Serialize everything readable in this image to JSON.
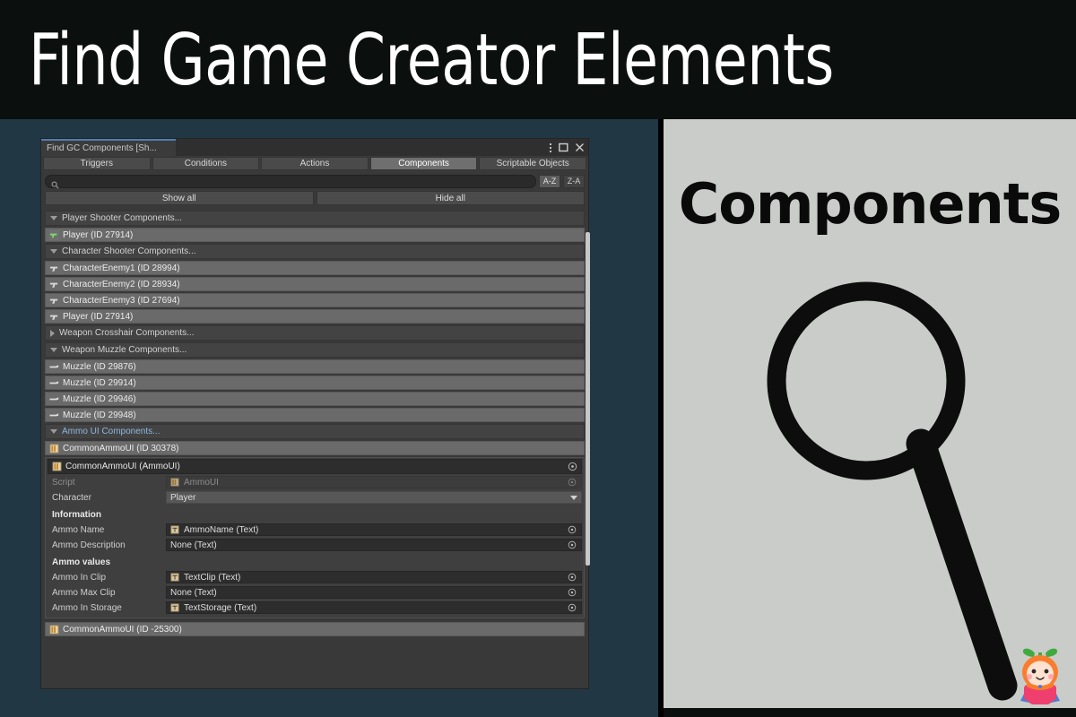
{
  "banner": {
    "title": "Find Game Creator Elements"
  },
  "right_panel": {
    "heading": "Components",
    "magnifier_icon": "search-icon",
    "mascot_icon": "mascot-character-icon",
    "bg_color": "#c9ccc9"
  },
  "window": {
    "tab_title": "Find GC Components [Sh...",
    "controls": {
      "menu": "kebab-menu-icon",
      "maximize": "maximize-icon",
      "close": "close-icon"
    },
    "accent_color": "#4b7fb5"
  },
  "tabs": [
    {
      "label": "Triggers",
      "active": false
    },
    {
      "label": "Conditions",
      "active": false
    },
    {
      "label": "Actions",
      "active": false
    },
    {
      "label": "Components",
      "active": true
    },
    {
      "label": "Scriptable Objects",
      "active": false
    }
  ],
  "search": {
    "value": "",
    "placeholder": "",
    "icon": "search-icon"
  },
  "sort": {
    "asc_label": "A-Z",
    "desc_label": "Z-A",
    "selected": "A-Z"
  },
  "actions": {
    "show_all": "Show all",
    "hide_all": "Hide all"
  },
  "groups": [
    {
      "label": "Player Shooter Components...",
      "expanded": true,
      "accent": false,
      "icon": "player-shooter-icon",
      "items": [
        {
          "label": "Player (ID 27914)",
          "icon": "gun-green-icon"
        }
      ]
    },
    {
      "label": "Character Shooter Components...",
      "expanded": true,
      "accent": false,
      "icon": "character-shooter-icon",
      "items": [
        {
          "label": "CharacterEnemy1 (ID 28994)",
          "icon": "gun-icon"
        },
        {
          "label": "CharacterEnemy2 (ID 28934)",
          "icon": "gun-icon"
        },
        {
          "label": "CharacterEnemy3 (ID 27694)",
          "icon": "gun-icon"
        },
        {
          "label": "Player (ID 27914)",
          "icon": "gun-icon"
        }
      ]
    },
    {
      "label": "Weapon Crosshair Components...",
      "expanded": false,
      "accent": false,
      "items": []
    },
    {
      "label": "Weapon Muzzle Components...",
      "expanded": true,
      "accent": false,
      "items": [
        {
          "label": "Muzzle (ID 29876)",
          "icon": "muzzle-icon"
        },
        {
          "label": "Muzzle (ID 29914)",
          "icon": "muzzle-icon"
        },
        {
          "label": "Muzzle (ID 29946)",
          "icon": "muzzle-icon"
        },
        {
          "label": "Muzzle (ID 29948)",
          "icon": "muzzle-icon"
        }
      ]
    },
    {
      "label": "Ammo UI Components...",
      "expanded": true,
      "accent": true,
      "items": [
        {
          "label": "CommonAmmoUI (ID 30378)",
          "icon": "ui-script-icon"
        }
      ]
    }
  ],
  "inspector": {
    "header": {
      "label": "CommonAmmoUI (AmmoUI)",
      "icon": "ui-script-icon",
      "object_picker": "object-picker-icon"
    },
    "fields": [
      {
        "label": "Script",
        "value": "AmmoUI",
        "type": "object",
        "icon": "ui-script-icon",
        "disabled": true
      },
      {
        "label": "Character",
        "value": "Player",
        "type": "dropdown",
        "disabled": false
      }
    ],
    "sections": [
      {
        "title": "Information",
        "fields": [
          {
            "label": "Ammo Name",
            "value": "AmmoName (Text)",
            "type": "object",
            "icon": "text-icon",
            "has_icon": true
          },
          {
            "label": "Ammo Description",
            "value": "None (Text)",
            "type": "object",
            "has_icon": false
          }
        ]
      },
      {
        "title": "Ammo values",
        "fields": [
          {
            "label": "Ammo In Clip",
            "value": "TextClip (Text)",
            "type": "object",
            "icon": "text-icon",
            "has_icon": true
          },
          {
            "label": "Ammo Max Clip",
            "value": "None (Text)",
            "type": "object",
            "has_icon": false
          },
          {
            "label": "Ammo In Storage",
            "value": "TextStorage (Text)",
            "type": "object",
            "icon": "text-icon",
            "has_icon": true
          }
        ]
      }
    ]
  },
  "trailing_item": {
    "label": "CommonAmmoUI (ID -25300)",
    "icon": "ui-script-icon"
  }
}
